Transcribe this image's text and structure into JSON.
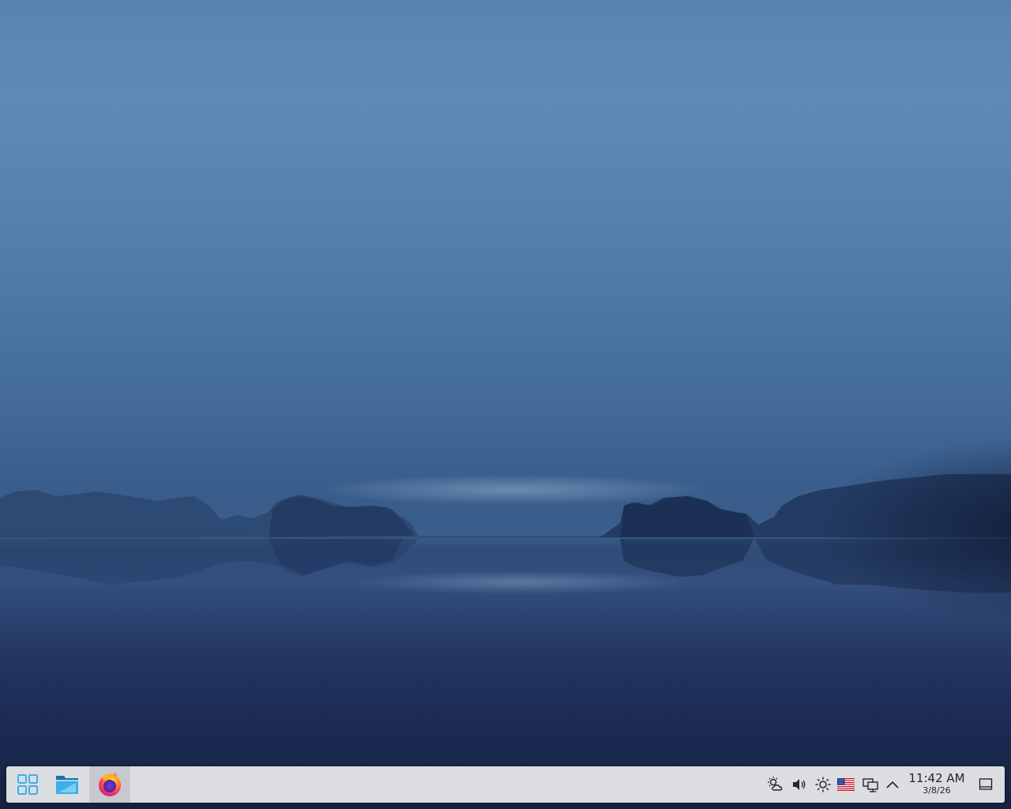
{
  "taskbar": {
    "launchers": [
      {
        "name": "application-launcher",
        "icon": "app-grid-icon"
      },
      {
        "name": "file-manager",
        "icon": "folder-icon"
      },
      {
        "name": "firefox",
        "icon": "firefox-icon",
        "active": true
      }
    ],
    "tray": [
      {
        "icon": "weather-icon"
      },
      {
        "icon": "volume-icon"
      },
      {
        "icon": "brightness-icon"
      },
      {
        "icon": "us-flag-icon"
      },
      {
        "icon": "network-icon"
      },
      {
        "icon": "chevron-up-icon"
      }
    ],
    "clock": {
      "time": "11:42 AM",
      "date": "3/8/26"
    },
    "show_desktop_icon": "show-desktop-icon"
  },
  "colors": {
    "accent": "#3daee9",
    "taskbar_bg": "#dcdde1",
    "text": "#232629"
  }
}
